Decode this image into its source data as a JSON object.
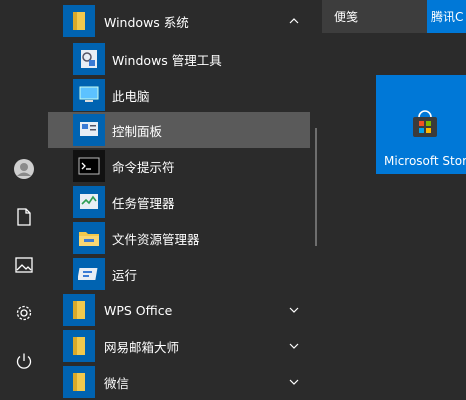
{
  "left_rail": {
    "items": [
      {
        "name": "avatar"
      },
      {
        "name": "documents-icon"
      },
      {
        "name": "pictures-icon"
      },
      {
        "name": "settings-icon"
      },
      {
        "name": "power-icon"
      }
    ]
  },
  "app_list": {
    "folders": {
      "windows_system": "Windows 系统",
      "wps_office": "WPS Office",
      "netease_mail": "网易邮箱大师",
      "wechat": "微信"
    },
    "windows_system_items": [
      "Windows 管理工具",
      "此电脑",
      "控制面板",
      "命令提示符",
      "任务管理器",
      "文件资源管理器",
      "运行"
    ]
  },
  "tiles": {
    "bianjian": "便笺",
    "tencent": "腾讯C",
    "microsoft_store": "Microsoft Store"
  },
  "colors": {
    "background": "#2b2b2b",
    "tile_blue": "#0063b1",
    "accent": "#0078d7",
    "selected_row": "#5a5a5a"
  }
}
